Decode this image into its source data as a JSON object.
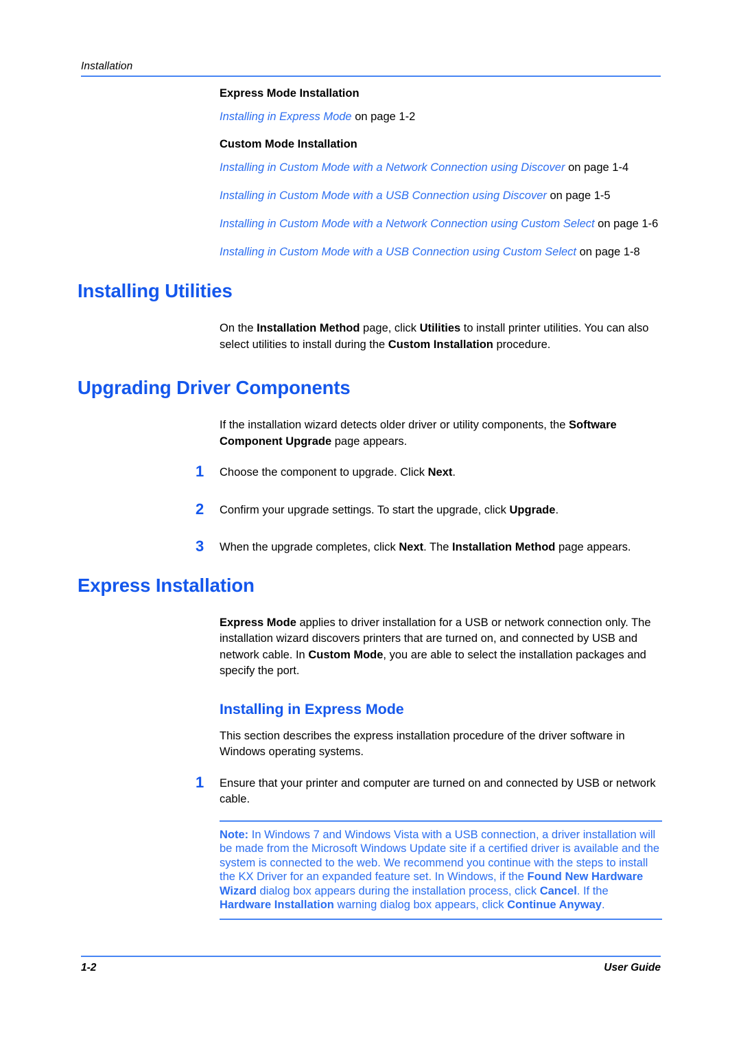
{
  "header": {
    "running_title": "Installation"
  },
  "xref_section": {
    "groups": [
      {
        "heading": "Express Mode Installation",
        "links": [
          {
            "link_text": "Installing in Express Mode",
            "tail": " on page 1-2"
          }
        ]
      },
      {
        "heading": "Custom Mode Installation",
        "links": [
          {
            "link_text": "Installing in Custom Mode with a Network Connection using Discover",
            "tail": " on page 1-4"
          },
          {
            "link_text": "Installing in Custom Mode with a USB Connection using Discover",
            "tail": " on page 1-5"
          },
          {
            "link_text": "Installing in Custom Mode with a Network Connection using Custom Select",
            "tail": " on page 1-6"
          },
          {
            "link_text": "Installing in Custom Mode with a USB Connection using Custom Select",
            "tail": " on page 1-8"
          }
        ]
      }
    ]
  },
  "installing_utilities": {
    "heading": "Installing Utilities",
    "paragraph_parts": [
      {
        "text": "On the ",
        "bold": false
      },
      {
        "text": "Installation Method",
        "bold": true
      },
      {
        "text": " page, click ",
        "bold": false
      },
      {
        "text": "Utilities",
        "bold": true
      },
      {
        "text": " to install printer utilities. You can also select utilities to install during the ",
        "bold": false
      },
      {
        "text": "Custom Installation",
        "bold": true
      },
      {
        "text": " procedure.",
        "bold": false
      }
    ]
  },
  "upgrading_driver_components": {
    "heading": "Upgrading Driver Components",
    "intro_parts": [
      {
        "text": "If the installation wizard detects older driver or utility components, the ",
        "bold": false
      },
      {
        "text": "Software Component Upgrade",
        "bold": true
      },
      {
        "text": " page appears.",
        "bold": false
      }
    ],
    "steps": [
      {
        "number": "1",
        "parts": [
          {
            "text": "Choose the component to upgrade. Click ",
            "bold": false
          },
          {
            "text": "Next",
            "bold": true
          },
          {
            "text": ".",
            "bold": false
          }
        ]
      },
      {
        "number": "2",
        "parts": [
          {
            "text": "Confirm your upgrade settings. To start the upgrade, click ",
            "bold": false
          },
          {
            "text": "Upgrade",
            "bold": true
          },
          {
            "text": ".",
            "bold": false
          }
        ]
      },
      {
        "number": "3",
        "parts": [
          {
            "text": "When the upgrade completes, click ",
            "bold": false
          },
          {
            "text": "Next",
            "bold": true
          },
          {
            "text": ". The ",
            "bold": false
          },
          {
            "text": "Installation Method",
            "bold": true
          },
          {
            "text": " page appears.",
            "bold": false
          }
        ]
      }
    ]
  },
  "express_installation": {
    "heading": "Express Installation",
    "intro_parts": [
      {
        "text": "Express Mode",
        "bold": true
      },
      {
        "text": " applies to driver installation for a USB or network connection only. The installation wizard discovers printers that are turned on, and connected by USB and network cable. In ",
        "bold": false
      },
      {
        "text": "Custom Mode",
        "bold": true
      },
      {
        "text": ", you are able to select the installation packages and specify the port.",
        "bold": false
      }
    ],
    "subsection": {
      "heading": "Installing in Express Mode",
      "paragraph": "This section describes the express installation procedure of the driver software in Windows operating systems.",
      "steps": [
        {
          "number": "1",
          "parts": [
            {
              "text": "Ensure that your printer and computer are turned on and connected by USB or network cable.",
              "bold": false
            }
          ]
        }
      ],
      "note": {
        "label": "Note:",
        "parts": [
          {
            "text": "  In Windows 7 and Windows Vista with a USB connection, a driver installation will be made from the Microsoft Windows Update site if a certified driver is available and the system is connected to the web. We recommend you continue with the steps to install the KX Driver for an expanded feature set. In Windows, if the ",
            "bold": false
          },
          {
            "text": "Found New Hardware Wizard",
            "bold": true
          },
          {
            "text": " dialog box appears during the installation process, click ",
            "bold": false
          },
          {
            "text": "Cancel",
            "bold": true
          },
          {
            "text": ". If the ",
            "bold": false
          },
          {
            "text": "Hardware Installation",
            "bold": true
          },
          {
            "text": " warning dialog box appears, click ",
            "bold": false
          },
          {
            "text": "Continue Anyway",
            "bold": true
          },
          {
            "text": ".",
            "bold": false
          }
        ]
      }
    }
  },
  "footer": {
    "page_number": "1-2",
    "guide_label": "User Guide"
  },
  "colors": {
    "heading_blue": "#1457ec",
    "link_blue": "#2c6ef0",
    "rule_blue": "#4785f4",
    "body_black": "#000000"
  }
}
